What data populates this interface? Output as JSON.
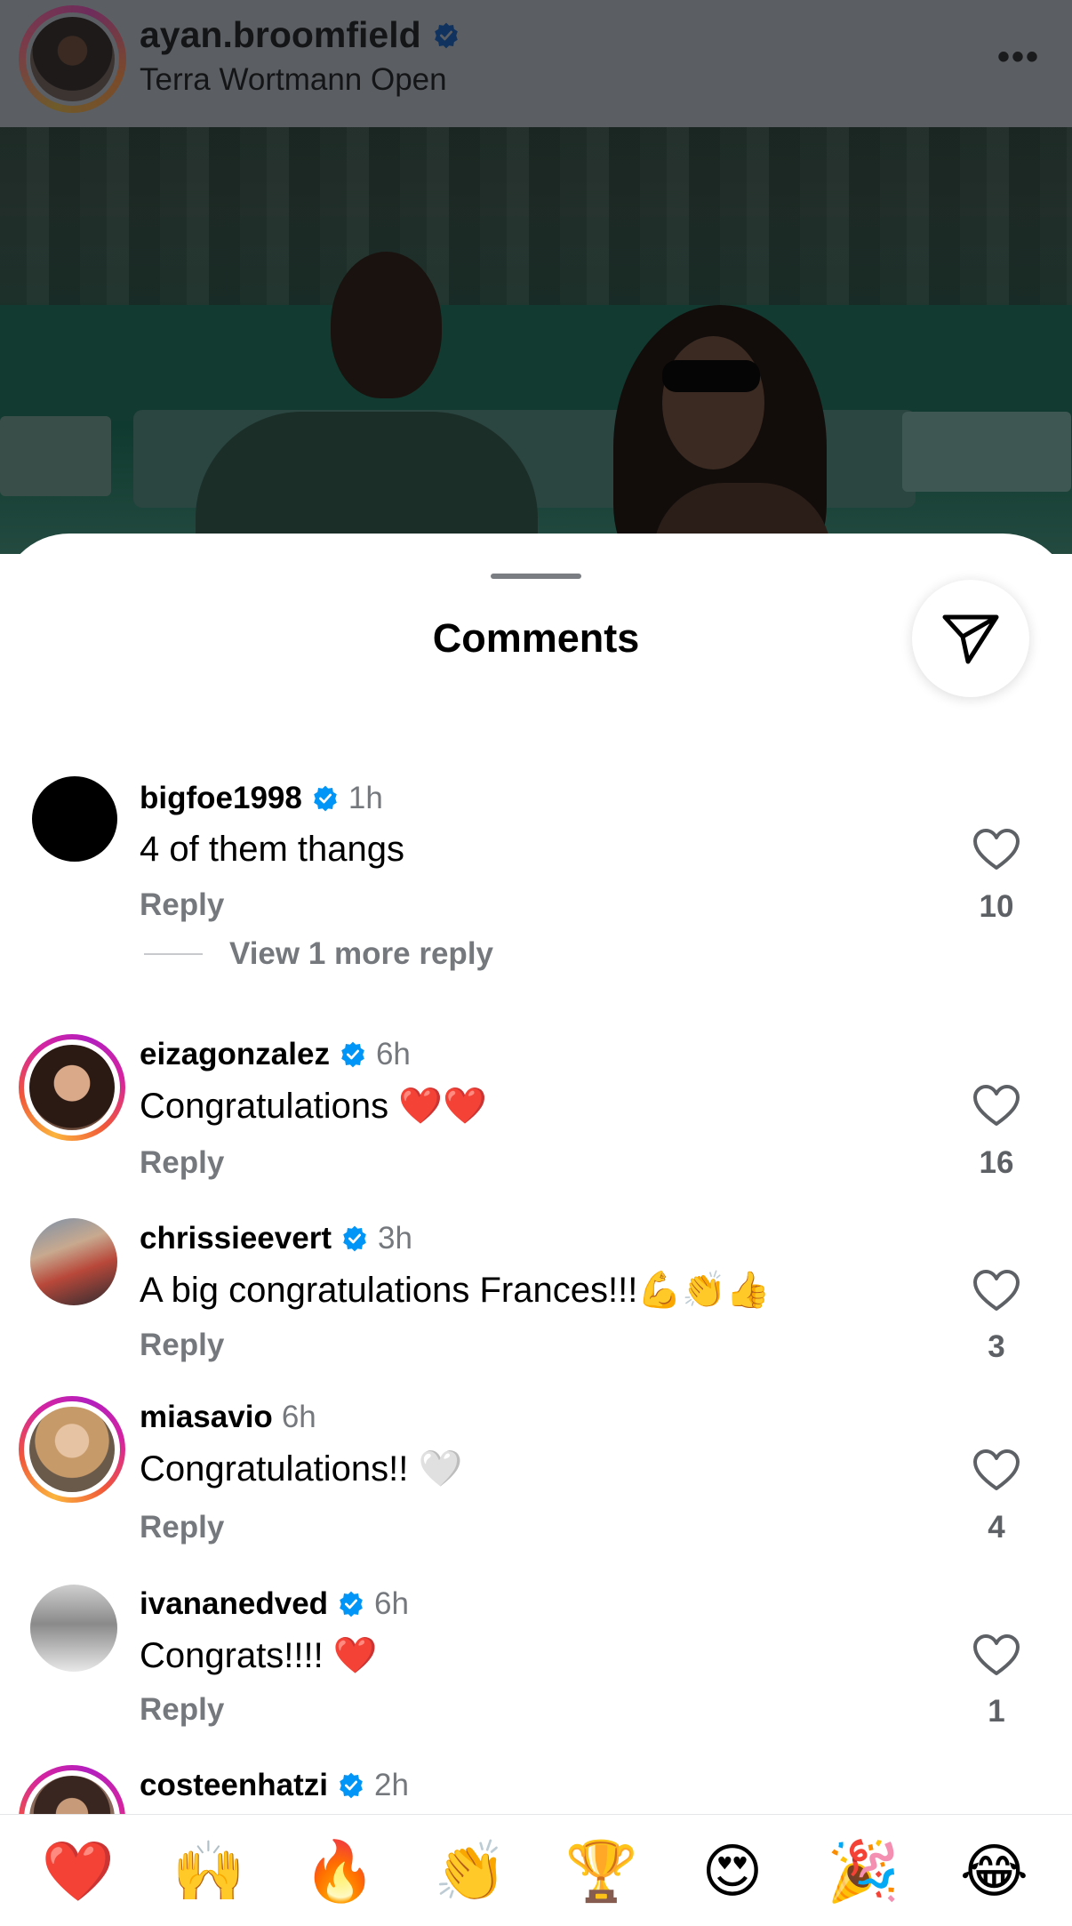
{
  "post": {
    "username": "ayan.broomfield",
    "location": "Terra Wortmann Open"
  },
  "sheet": {
    "title": "Comments"
  },
  "comments": [
    {
      "username": "bigfoe1998",
      "time": "1h",
      "text": "4 of them thangs",
      "reply_label": "Reply",
      "likes": "10"
    },
    {
      "username": "eizagonzalez",
      "time": "6h",
      "text": "Congratulations ❤️❤️",
      "reply_label": "Reply",
      "likes": "16"
    },
    {
      "username": "chrissieevert",
      "time": "3h",
      "text": "A big congratulations Frances!!!💪👏👍",
      "reply_label": "Reply",
      "likes": "3"
    },
    {
      "username": "miasavio",
      "time": "6h",
      "text": "Congratulations!! 🤍",
      "reply_label": "Reply",
      "likes": "4"
    },
    {
      "username": "ivananedved",
      "time": "6h",
      "text": "Congrats!!!! ❤️",
      "reply_label": "Reply",
      "likes": "1"
    },
    {
      "username": "costeenhatzi",
      "time": "2h"
    }
  ],
  "view_more": {
    "label": "View 1 more reply"
  },
  "reactions": [
    "❤️",
    "🙌",
    "🔥",
    "👏",
    "🏆",
    "😍",
    "🎉",
    "😂"
  ],
  "colors": {
    "verified": "#0095f6",
    "secondary_text": "#75797e"
  }
}
